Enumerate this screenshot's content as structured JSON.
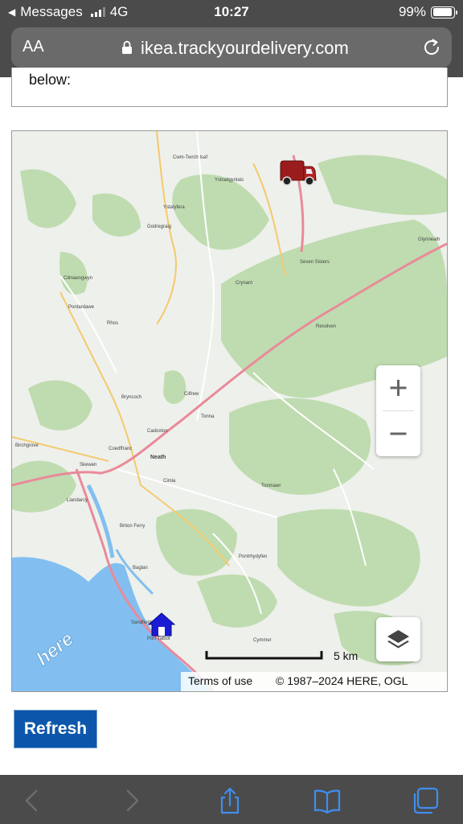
{
  "status_bar": {
    "back_app": "Messages",
    "network": "4G",
    "time": "10:27",
    "battery": "99%",
    "icons": [
      "back-arrow-icon",
      "signal-icon",
      "battery-icon"
    ]
  },
  "browser": {
    "text_size_label": "AA",
    "url": "ikea.trackyourdelivery.com",
    "icons": [
      "lock-icon",
      "reload-icon"
    ]
  },
  "page": {
    "intro_text_fragment": "below:",
    "map": {
      "place_labels": [
        "Ystradgynlais",
        "Cwm-Twrch Isaf",
        "Ystalyfera",
        "Godregraig",
        "Cilmaengwyn",
        "Pontardawe",
        "Rhos",
        "Crynant",
        "Seven Sisters",
        "Resolven",
        "Glynneath",
        "Bryncoch",
        "Cilfrew",
        "Tonna",
        "Cadoxton",
        "Neath",
        "Skewen",
        "Cimla",
        "Briton Ferry",
        "Baglan",
        "Port Talbot",
        "Sandfields",
        "Cymmer",
        "Pontrhydyfen",
        "Tonmawr",
        "Llandarcy",
        "Birchgrove",
        "Coedffranc"
      ],
      "markers": [
        "delivery-van-icon",
        "destination-home-icon"
      ],
      "zoom_in_label": "+",
      "zoom_out_label": "−",
      "scale_label": "5 km",
      "terms_label": "Terms of use",
      "copyright": "© 1987–2024 HERE, OGL",
      "provider_logo": "here",
      "water_color": "#82bff0",
      "land_color": "#eef0eb",
      "forest_color": "#bfdcb0",
      "road_color": "#e98a9a"
    },
    "refresh_label": "Refresh",
    "refresh_color": "#0c57ab"
  },
  "toolbar": {
    "icons": [
      "back-icon",
      "forward-icon",
      "share-icon",
      "bookmarks-icon",
      "tabs-icon"
    ]
  }
}
